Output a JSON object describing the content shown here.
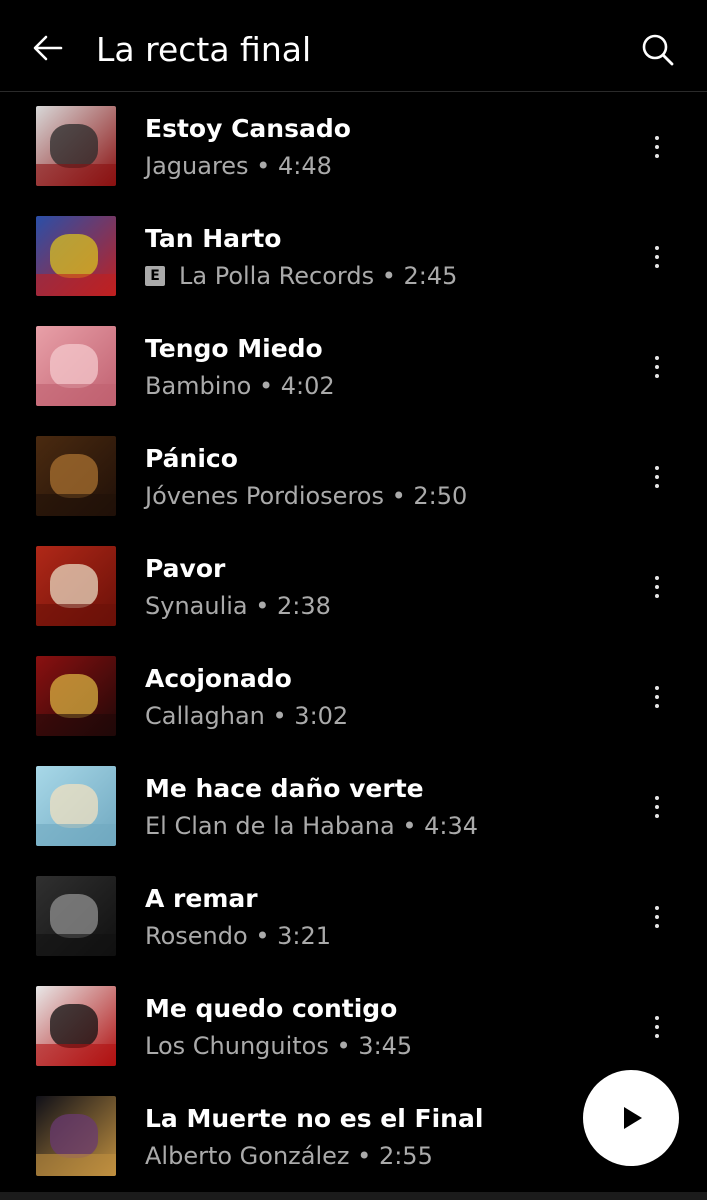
{
  "header": {
    "title": "La recta final",
    "back_icon": "arrow-left-icon",
    "search_icon": "search-icon"
  },
  "songs": [
    {
      "title": "Estoy Cansado",
      "artist": "Jaguares",
      "duration": "4:48",
      "explicit": false,
      "colors": [
        "#d8d8d8",
        "#2a2a2a",
        "#8a1010"
      ]
    },
    {
      "title": "Tan Harto",
      "artist": "La Polla Records",
      "duration": "2:45",
      "explicit": true,
      "colors": [
        "#2a4fa8",
        "#d8c020",
        "#c02020"
      ]
    },
    {
      "title": "Tengo Miedo",
      "artist": "Bambino",
      "duration": "4:02",
      "explicit": false,
      "colors": [
        "#e8a0a8",
        "#f4c8cc",
        "#c06070"
      ]
    },
    {
      "title": "Pánico",
      "artist": "Jóvenes Pordioseros",
      "duration": "2:50",
      "explicit": false,
      "colors": [
        "#4a2a10",
        "#a87030",
        "#201008"
      ]
    },
    {
      "title": "Pavor",
      "artist": "Synaulia",
      "duration": "2:38",
      "explicit": false,
      "colors": [
        "#b02818",
        "#e8d8c0",
        "#6a1008"
      ]
    },
    {
      "title": "Acojonado",
      "artist": "Callaghan",
      "duration": "3:02",
      "explicit": false,
      "colors": [
        "#8a1010",
        "#d8b040",
        "#200808"
      ]
    },
    {
      "title": "Me hace daño verte",
      "artist": "El Clan de la Habana",
      "duration": "4:34",
      "explicit": false,
      "colors": [
        "#a8d8e8",
        "#f0e0c0",
        "#70a8c0"
      ]
    },
    {
      "title": "A remar",
      "artist": "Rosendo",
      "duration": "3:21",
      "explicit": false,
      "colors": [
        "#303030",
        "#909090",
        "#101010"
      ]
    },
    {
      "title": "Me quedo contigo",
      "artist": "Los Chunguitos",
      "duration": "3:45",
      "explicit": false,
      "colors": [
        "#e8e8e8",
        "#101010",
        "#b01010"
      ]
    },
    {
      "title": "La Muerte no es el Final",
      "artist": "Alberto González",
      "duration": "2:55",
      "explicit": false,
      "colors": [
        "#101018",
        "#6a3a70",
        "#c09040"
      ]
    }
  ],
  "explicit_badge": "E",
  "separator": " • ",
  "fab": {
    "icon": "play-icon"
  }
}
